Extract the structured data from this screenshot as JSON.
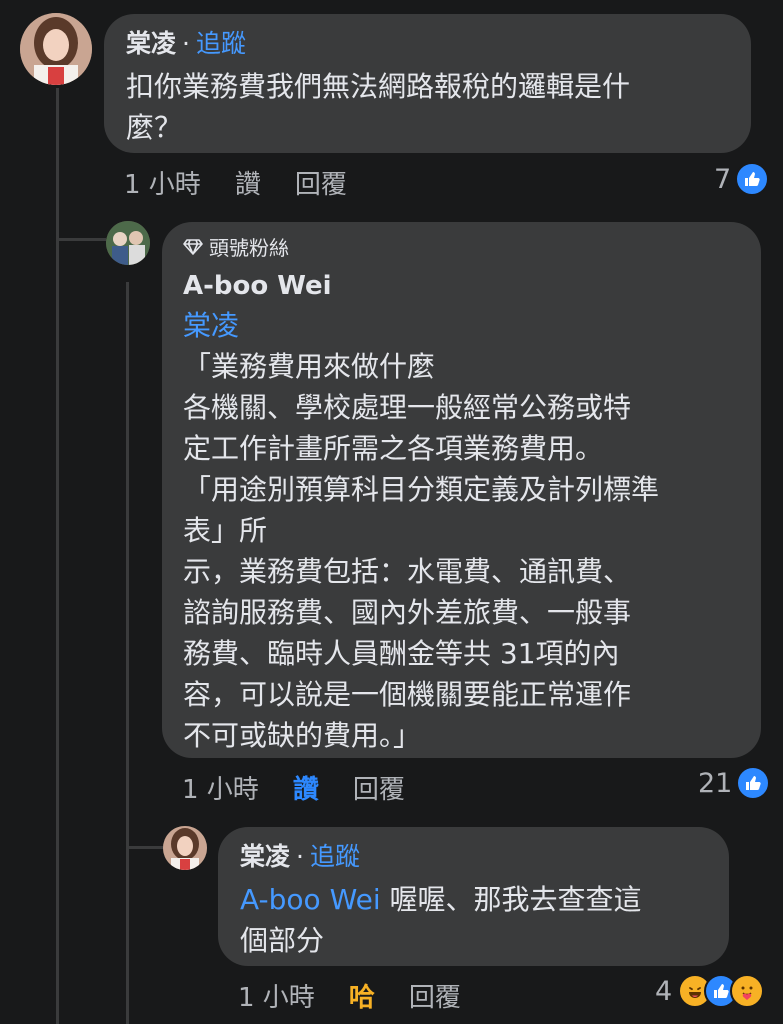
{
  "comment1": {
    "author": "棠凌",
    "separator": "·",
    "follow": "追蹤",
    "text": "扣你業務費我們無法網路報稅的邏輯是什\n麼？",
    "time": "1 小時",
    "like": "讚",
    "reply": "回覆",
    "reaction_count": "7"
  },
  "comment2": {
    "badge": "頭號粉絲",
    "author": "A-boo Wei",
    "mention": "棠凌",
    "text": "「業務費用來做什麼\n各機關、學校處理一般經常公務或特\n定工作計畫所需之各項業務費用。\n「用途別預算科目分類定義及計列標準\n表」所\n示，業務費包括：水電費、通訊費、\n諮詢服務費、國內外差旅費、一般事\n務費、臨時人員酬金等共 31項的內\n容，可以說是一個機關要能正常運作\n不可或缺的費用。」",
    "time": "1 小時",
    "like": "讚",
    "reply": "回覆",
    "reaction_count": "21"
  },
  "comment3": {
    "author": "棠凌",
    "separator": "·",
    "follow": "追蹤",
    "mention": "A-boo Wei",
    "text_line1": " 喔喔、那我去查查這",
    "text_line2": "個部分",
    "time": "1 小時",
    "reaction_label": "哈",
    "reply": "回覆",
    "reaction_count": "4"
  },
  "colors": {
    "background": "#18191a",
    "bubble": "#3a3b3c",
    "link": "#4599ff",
    "like": "#2d88ff",
    "haha": "#f7b125",
    "love": "#f3425f"
  }
}
